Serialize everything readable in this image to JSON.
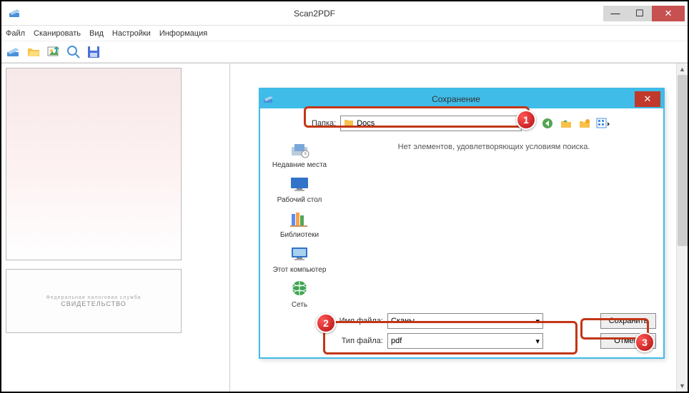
{
  "window": {
    "title": "Scan2PDF",
    "menu": {
      "file": "Файл",
      "scan": "Сканировать",
      "view": "Вид",
      "settings": "Настройки",
      "info": "Информация"
    }
  },
  "thumbs": {
    "cert_title": "СВИДЕТЕЛЬСТВО",
    "cert_sub": "Федеральная налоговая служба"
  },
  "dialog": {
    "title": "Сохранение",
    "folder_label": "Папка:",
    "folder_value": "Docs",
    "empty_msg": "Нет элементов, удовлетворяющих условиям поиска.",
    "places": {
      "recent": "Недавние места",
      "desktop": "Рабочий стол",
      "libraries": "Библиотеки",
      "computer": "Этот компьютер",
      "network": "Сеть"
    },
    "filename_label": "Имя файла:",
    "filename_value": "Сканы",
    "filetype_label": "Тип файла:",
    "filetype_value": "pdf",
    "save_btn": "Сохранить",
    "cancel_btn": "Отмена"
  },
  "badges": {
    "n1": "1",
    "n2": "2",
    "n3": "3"
  }
}
